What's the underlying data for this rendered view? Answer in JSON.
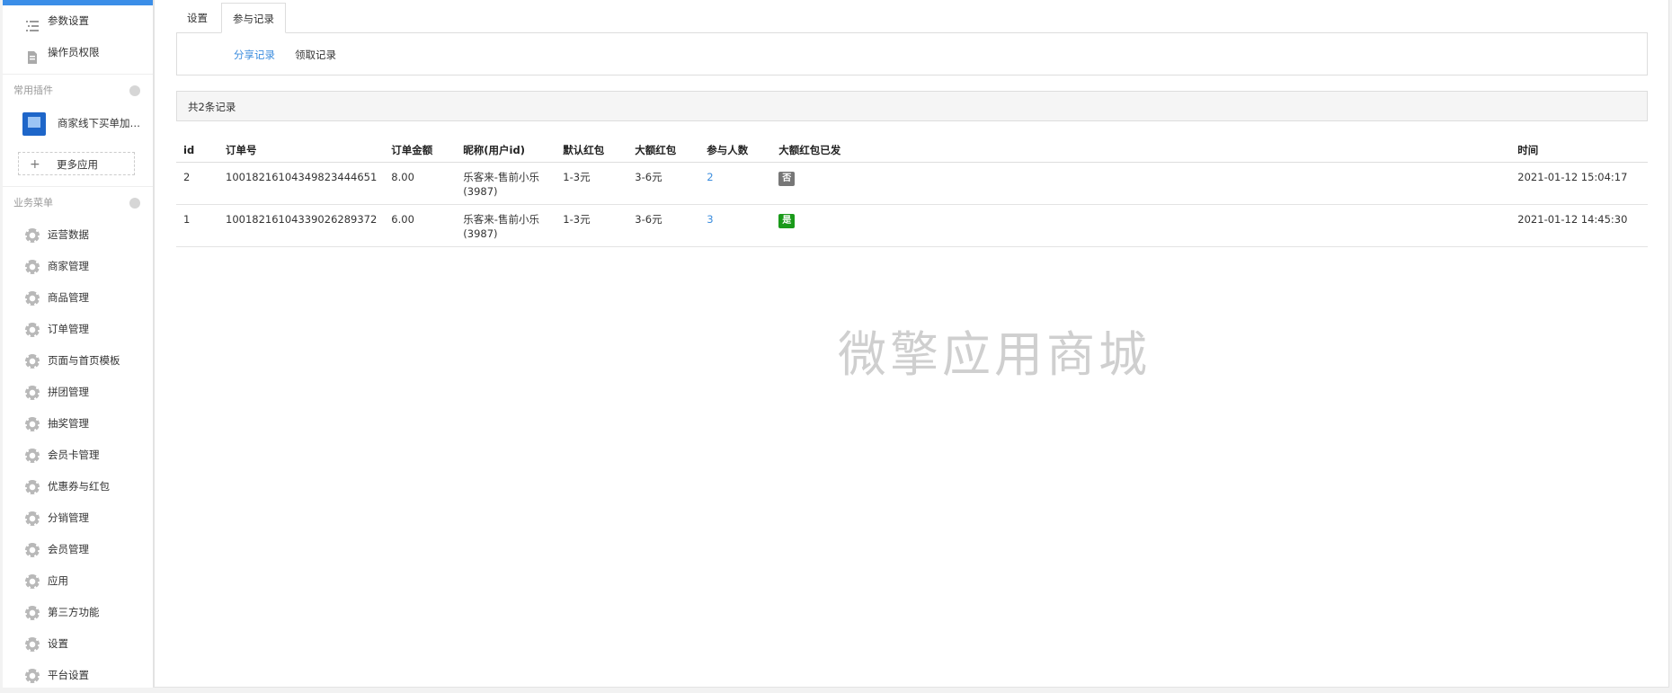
{
  "sidebar": {
    "top_items": [
      {
        "label": "参数设置",
        "icon": "list-icon"
      },
      {
        "label": "操作员权限",
        "icon": "document-icon"
      }
    ],
    "plugins_section": {
      "title": "常用插件"
    },
    "plugin": {
      "label": "商家线下买单加独..."
    },
    "more_apps": {
      "label": "更多应用"
    },
    "business_section": {
      "title": "业务菜单"
    },
    "menu_items": [
      {
        "label": "运营数据"
      },
      {
        "label": "商家管理"
      },
      {
        "label": "商品管理"
      },
      {
        "label": "订单管理"
      },
      {
        "label": "页面与首页模板"
      },
      {
        "label": "拼团管理"
      },
      {
        "label": "抽奖管理"
      },
      {
        "label": "会员卡管理"
      },
      {
        "label": "优惠券与红包"
      },
      {
        "label": "分销管理"
      },
      {
        "label": "会员管理"
      },
      {
        "label": "应用"
      },
      {
        "label": "第三方功能"
      },
      {
        "label": "设置"
      },
      {
        "label": "平台设置"
      }
    ]
  },
  "tabs": [
    {
      "label": "设置",
      "active": false
    },
    {
      "label": "参与记录",
      "active": true
    }
  ],
  "subnav": [
    {
      "label": "分享记录",
      "active": true
    },
    {
      "label": "领取记录",
      "active": false
    }
  ],
  "summary": {
    "text": "共2条记录"
  },
  "table": {
    "columns": [
      "id",
      "订单号",
      "订单金额",
      "昵称(用户id)",
      "默认红包",
      "大额红包",
      "参与人数",
      "大额红包已发",
      "时间"
    ],
    "rows": [
      {
        "id": "2",
        "order_no": "10018216104349823444651",
        "amount": "8.00",
        "nickname": "乐客来-售前小乐",
        "user_id": "(3987)",
        "default_packet": "1-3元",
        "large_packet": "3-6元",
        "participants": "2",
        "large_sent": "否",
        "time": "2021-01-12 15:04:17"
      },
      {
        "id": "1",
        "order_no": "10018216104339026289372",
        "amount": "6.00",
        "nickname": "乐客来-售前小乐",
        "user_id": "(3987)",
        "default_packet": "1-3元",
        "large_packet": "3-6元",
        "participants": "3",
        "large_sent": "是",
        "time": "2021-01-12 14:45:30"
      }
    ]
  },
  "watermark": {
    "text": "微擎应用商城"
  },
  "colors": {
    "accent": "#3c8dde",
    "badge_no": "#777777",
    "badge_yes": "#1a9a1a",
    "topbar": "#3b8ee8"
  }
}
